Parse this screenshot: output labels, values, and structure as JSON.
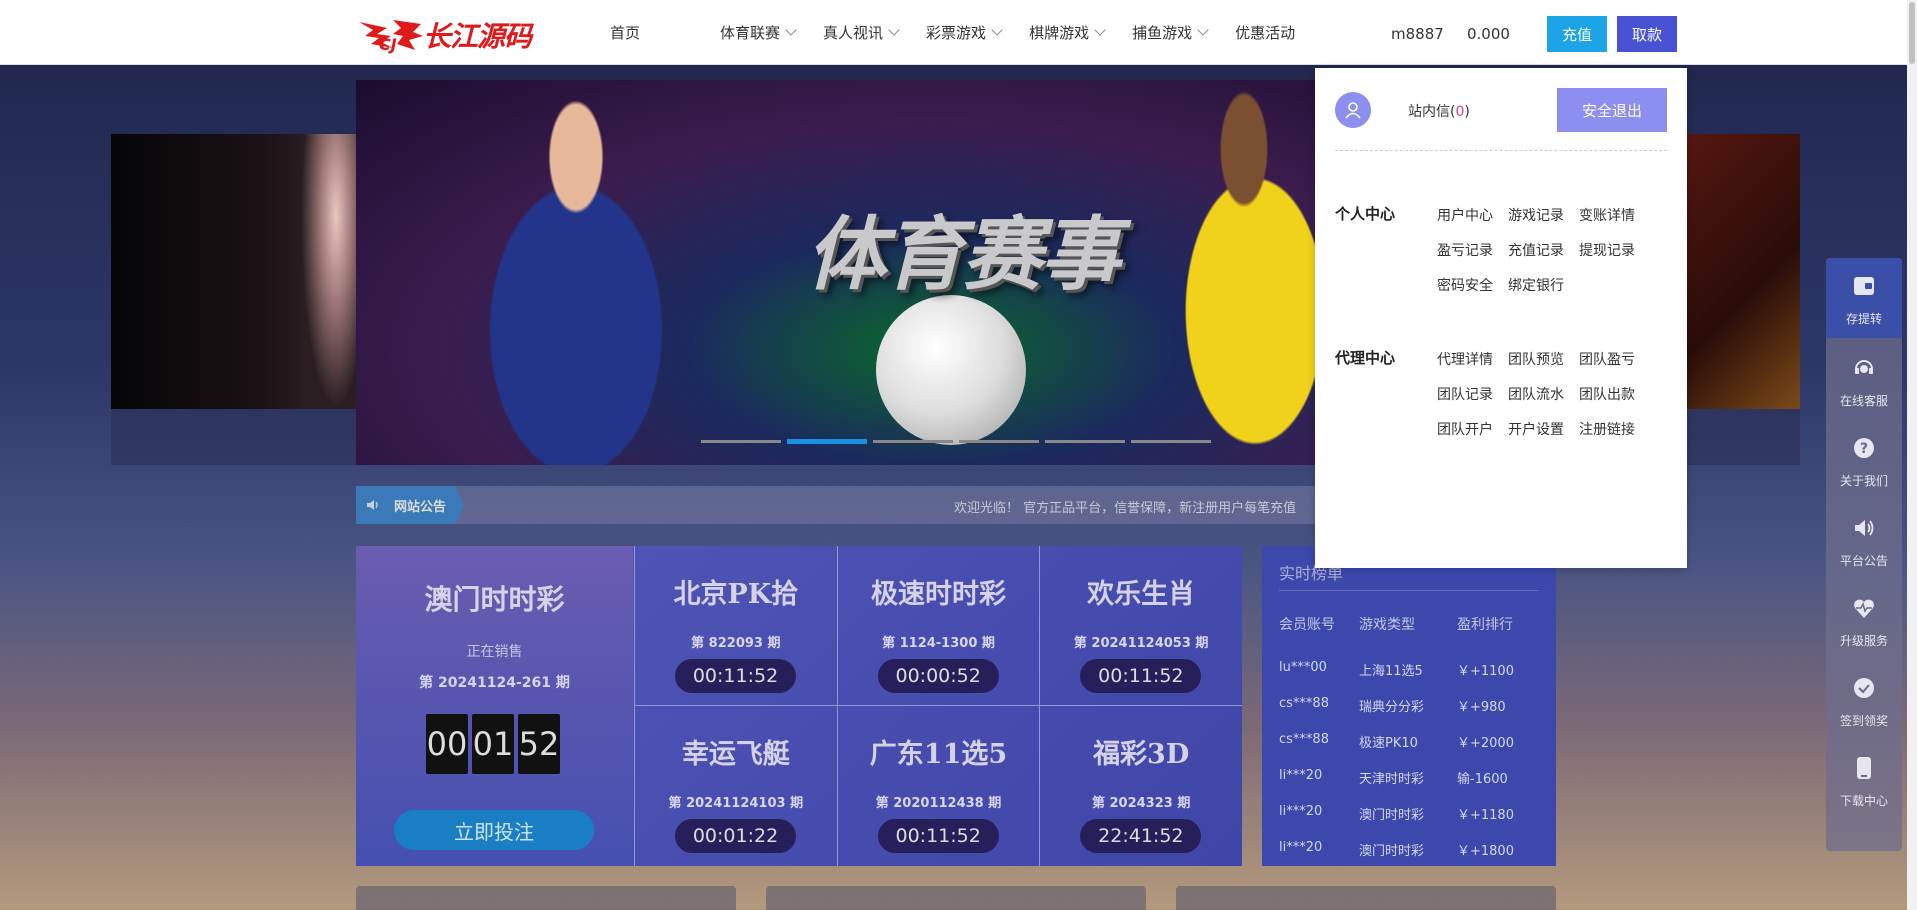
{
  "header": {
    "logo_text": "长江源码",
    "nav": [
      "首页",
      "体育联赛",
      "真人视讯",
      "彩票游戏",
      "棋牌游戏",
      "捕鱼游戏",
      "优惠活动"
    ],
    "username": "m8887",
    "balance": "0.000",
    "deposit_label": "充值",
    "withdraw_label": "取款"
  },
  "banner": {
    "title": "体育赛事",
    "active_slide": 2,
    "slide_count": 6
  },
  "notice": {
    "label": "网站公告",
    "text": "欢迎光临！ 官方正品平台，信誉保障，新注册用户每笔充值"
  },
  "lottery": {
    "main": {
      "name": "澳门时时彩",
      "status": "正在销售",
      "period": "第 20241124-261 期",
      "timer": [
        "00",
        "01",
        "52"
      ],
      "bet_label": "立即投注"
    },
    "games": [
      {
        "name": "北京PK拾",
        "period": "第 822093 期",
        "timer": "00:11:52"
      },
      {
        "name": "极速时时彩",
        "period": "第 1124-1300 期",
        "timer": "00:00:52"
      },
      {
        "name": "欢乐生肖",
        "period": "第 20241124053 期",
        "timer": "00:11:52"
      },
      {
        "name": "幸运飞艇",
        "period": "第 20241124103 期",
        "timer": "00:01:22"
      },
      {
        "name": "广东11选5",
        "period": "第 2020112438 期",
        "timer": "00:11:52"
      },
      {
        "name": "福彩3D",
        "period": "第 2024323 期",
        "timer": "22:41:52"
      }
    ]
  },
  "ranking": {
    "title": "实时榜单",
    "headers": [
      "会员账号",
      "游戏类型",
      "盈利排行"
    ],
    "rows": [
      [
        "lu***00",
        "上海11选5",
        "￥+1100"
      ],
      [
        "cs***88",
        "瑞典分分彩",
        "￥+980"
      ],
      [
        "cs***88",
        "极速PK10",
        "￥+2000"
      ],
      [
        "li***20",
        "天津时时彩",
        "输-1600"
      ],
      [
        "li***20",
        "澳门时时彩",
        "￥+1180"
      ],
      [
        "li***20",
        "澳门时时彩",
        "￥+1800"
      ]
    ]
  },
  "dropdown": {
    "messages_label": "站内信(",
    "messages_count": "0",
    "messages_close": ")",
    "logout_label": "安全退出",
    "personal_title": "个人中心",
    "personal_links": [
      "用户中心",
      "游戏记录",
      "变账详情",
      "盈亏记录",
      "充值记录",
      "提现记录",
      "密码安全",
      "绑定银行"
    ],
    "agent_title": "代理中心",
    "agent_links": [
      "代理详情",
      "团队预览",
      "团队盈亏",
      "团队记录",
      "团队流水",
      "团队出款",
      "团队开户",
      "开户设置",
      "注册链接"
    ]
  },
  "sidebar": [
    {
      "label": "存提转",
      "icon": "wallet-icon"
    },
    {
      "label": "在线客服",
      "icon": "headset-icon"
    },
    {
      "label": "关于我们",
      "icon": "question-icon"
    },
    {
      "label": "平台公告",
      "icon": "speaker-icon"
    },
    {
      "label": "升级服务",
      "icon": "heartbeat-icon"
    },
    {
      "label": "签到领奖",
      "icon": "check-circle-icon"
    },
    {
      "label": "下载中心",
      "icon": "phone-icon"
    }
  ],
  "colors": {
    "deposit": "#1ba5e6",
    "withdraw": "#4a52d4",
    "logout": "#8d8ff0",
    "brand": "#e0191b"
  }
}
